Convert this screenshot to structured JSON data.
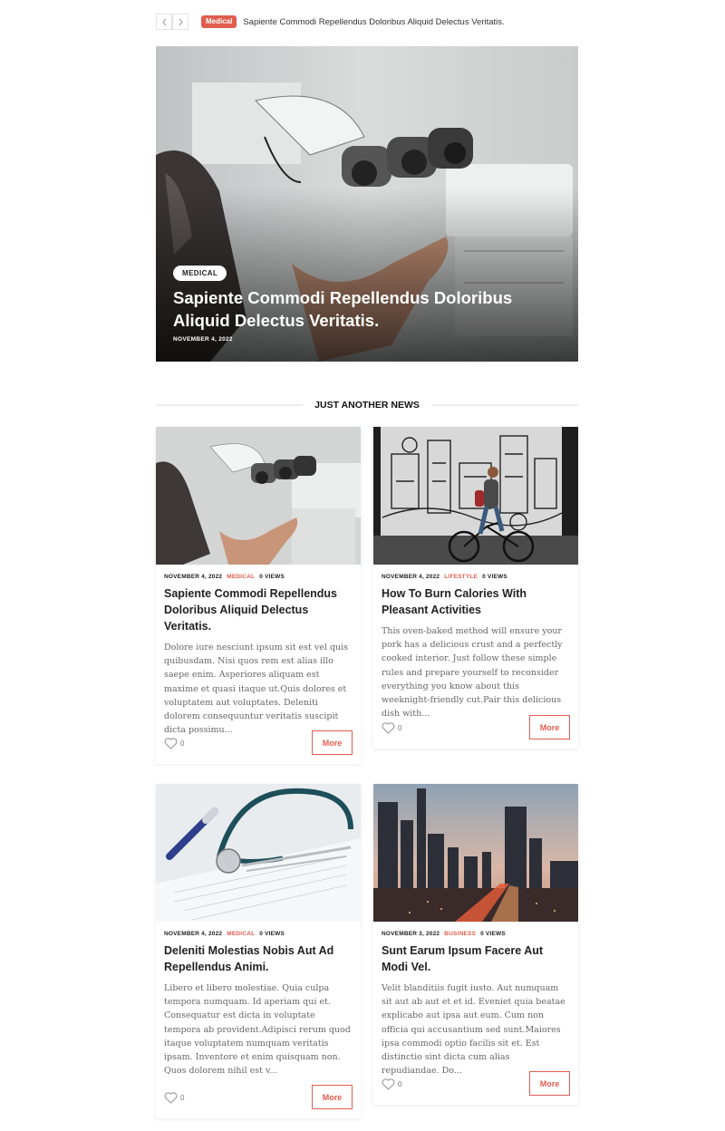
{
  "ticker": {
    "badge": "Medical",
    "text": "Sapiente Commodi Repellendus Doloribus Aliquid Delectus Veritatis."
  },
  "hero": {
    "category": "MEDICAL",
    "title": "Sapiente Commodi Repellendus Doloribus Aliquid Delectus Veritatis.",
    "date": "NOVEMBER 4, 2022"
  },
  "section": {
    "title": "JUST ANOTHER NEWS"
  },
  "posts": [
    {
      "date": "NOVEMBER 4, 2022",
      "category": "MEDICAL",
      "views": "0 VIEWS",
      "title": "Sapiente Commodi Repellendus Doloribus Aliquid Delectus Veritatis.",
      "excerpt": "Dolore iure nesciunt ipsum sit est vel quis quibusdam. Nisi quos rem est alias illo saepe enim. Asperiores aliquam est maxime et quasi itaque ut.Quis dolores et voluptatem aut voluptates. Deleniti dolorem consequuntur veritatis suscipit dicta possimu...",
      "likes": "0",
      "more": "More",
      "image": "dental-microscope"
    },
    {
      "date": "NOVEMBER 4, 2022",
      "category": "LIFESTYLE",
      "views": "0 VIEWS",
      "title": "How To Burn Calories With Pleasant Activities",
      "excerpt": "This oven-baked method will ensure your pork has a delicious crust and a perfectly cooked interior. Just follow these simple rules and prepare yourself to reconsider everything you know about this weeknight-friendly cut.Pair this delicious dish with...",
      "likes": "0",
      "more": "More",
      "image": "cyclist-mural"
    },
    {
      "date": "NOVEMBER 4, 2022",
      "category": "MEDICAL",
      "views": "0 VIEWS",
      "title": "Deleniti Molestias Nobis Aut Ad Repellendus Animi.",
      "excerpt": "Libero et libero molestiae. Quia culpa tempora numquam. Id aperiam qui et. Consequatur est dicta in voluptate tempora ab provident.Adipisci rerum quod itaque voluptatem numquam veritatis ipsam. Inventore et enim quisquam non. Quos dolorem nihil est v...",
      "likes": "0",
      "more": "More",
      "image": "stethoscope"
    },
    {
      "date": "NOVEMBER 3, 2022",
      "category": "BUSINESS",
      "views": "0 VIEWS",
      "title": "Sunt Earum Ipsum Facere Aut Modi Vel.",
      "excerpt": "Velit blanditiis fugit iusto. Aut numquam sit aut ab aut et et id. Eveniet quia beatae explicabo aut ipsa aut eum. Cum non officia qui accusantium sed sunt.Maiores ipsa commodi optio facilis sit et. Est distinctio sint dicta cum alias repudiandae. Do...",
      "likes": "0",
      "more": "More",
      "image": "city-skyline"
    }
  ],
  "colors": {
    "accent": "#e05d4f",
    "text": "#222222",
    "muted": "#666666"
  }
}
